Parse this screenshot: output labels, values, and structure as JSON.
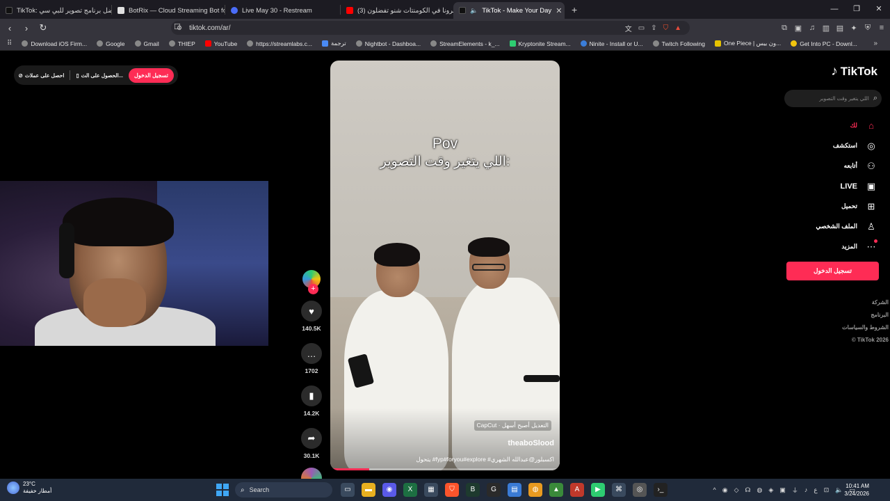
{
  "browser": {
    "tabs": [
      {
        "title": "TikTok: أفضل برنامج تصوير للبي سي |",
        "favicon_color": "#111111",
        "active": false
      },
      {
        "title": "BotRix — Cloud Streaming Bot for Tw",
        "favicon_color": "#e0e0e0",
        "active": false
      },
      {
        "title": "Live May 30 - Restream",
        "favicon_color": "#4a6cf7",
        "active": false
      },
      {
        "title": "(3) خبرونا في الكومنتات شنو تفضلون",
        "favicon_color": "#ff0000",
        "active": false
      },
      {
        "title": "TikTok - Make Your Day",
        "favicon_color": "#111111",
        "active": true
      }
    ],
    "new_tab_icon": "+",
    "window_controls": [
      "—",
      "❐",
      "✕"
    ],
    "url": "tiktok.com/ar/",
    "bookmarks": [
      {
        "label": "Download iOS Firm...",
        "color": "#aaaaaa"
      },
      {
        "label": "Google",
        "color": "#aaaaaa"
      },
      {
        "label": "Gmail",
        "color": "#aaaaaa"
      },
      {
        "label": "THIEP",
        "color": "#aaaaaa"
      },
      {
        "label": "YouTube",
        "color": "#ff0000"
      },
      {
        "label": "https://streamlabs.c...",
        "color": "#aaaaaa"
      },
      {
        "label": "ترجمة",
        "color": "#4a8af4"
      },
      {
        "label": "Nightbot - Dashboa...",
        "color": "#aaaaaa"
      },
      {
        "label": "StreamElements - k_...",
        "color": "#aaaaaa"
      },
      {
        "label": "Kryptonite Stream...",
        "color": "#2ecc71"
      },
      {
        "label": "Ninite - Install or U...",
        "color": "#3b7dd8"
      },
      {
        "label": "Twitch Following",
        "color": "#aaaaaa"
      },
      {
        "label": "One Piece | ون بيس...",
        "color": "#e6c200"
      },
      {
        "label": "Get Into PC - Downl...",
        "color": "#f1c40f"
      }
    ]
  },
  "tiktok": {
    "top_bar": {
      "login": "تسجيل الدخول",
      "get_app": "الحصول على الت...",
      "get_coins": "احصل على عملات"
    },
    "logo": "TikTok",
    "search_placeholder": "اللي يتغير وقت التصوير",
    "nav": [
      {
        "label": "لك",
        "icon": "home-icon",
        "glyph": "⌂"
      },
      {
        "label": "استكشف",
        "icon": "compass-icon",
        "glyph": "◎"
      },
      {
        "label": "أتابعه",
        "icon": "following-icon",
        "glyph": "⚇"
      },
      {
        "label": "LIVE",
        "icon": "live-icon",
        "glyph": "▣"
      },
      {
        "label": "تحميل",
        "icon": "upload-icon",
        "glyph": "⊞"
      },
      {
        "label": "الملف الشخصي",
        "icon": "profile-icon",
        "glyph": "♙"
      },
      {
        "label": "المزيد",
        "icon": "more-icon",
        "glyph": "⋯"
      }
    ],
    "login_button": "تسجيل الدخول",
    "footer": [
      "الشركة",
      "البرنامج",
      "الشروط والسياسات",
      "© TikTok 2026"
    ],
    "video": {
      "overlay_line1": "Pov",
      "overlay_line2": "اللي يتغير وقت التصوير:",
      "capcut": "CapCut · التعديل أصبح أسهل",
      "author": "theaboSlood",
      "description": "يتحول  #fyp#foryou#explore #اكسبلور@عبدالله الشهري",
      "progress": 0.17
    },
    "actions": {
      "likes": "140.5K",
      "comments": "1702",
      "saves": "14.2K",
      "shares": "30.1K"
    }
  },
  "taskbar": {
    "temperature": "23°C",
    "weather": "أمطار خفيفة",
    "search": "Search",
    "time": "10:41 AM",
    "date": "3/24/2026"
  }
}
